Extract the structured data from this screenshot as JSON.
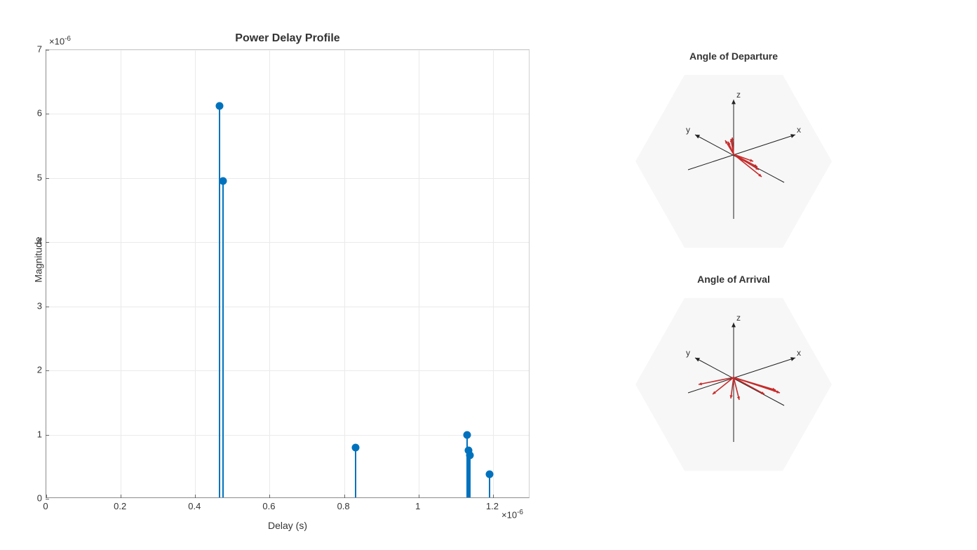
{
  "chart_data": [
    {
      "type": "stem",
      "title": "Power Delay Profile",
      "xlabel": "Delay (s)",
      "ylabel": "Magnitude",
      "xlim": [
        0,
        1.3e-06
      ],
      "ylim": [
        0,
        7e-06
      ],
      "x_exponent": "×10⁻⁶",
      "y_exponent": "×10⁻⁶",
      "xticks": [
        0,
        0.2,
        0.4,
        0.6,
        0.8,
        1.0,
        1.2
      ],
      "yticks": [
        0,
        1,
        2,
        3,
        4,
        5,
        6,
        7
      ],
      "points": [
        {
          "x": 4.65e-07,
          "y": 6.12e-06
        },
        {
          "x": 4.75e-07,
          "y": 4.95e-06
        },
        {
          "x": 8.3e-07,
          "y": 8e-07
        },
        {
          "x": 1.13e-06,
          "y": 1e-06
        },
        {
          "x": 1.135e-06,
          "y": 7.6e-07
        },
        {
          "x": 1.138e-06,
          "y": 6.8e-07
        },
        {
          "x": 1.19e-06,
          "y": 3.8e-07
        }
      ]
    },
    {
      "type": "vector3d",
      "title": "Angle of Departure",
      "axis_labels": {
        "x": "x",
        "y": "y",
        "z": "z"
      },
      "vectors": [
        {
          "dx": 28,
          "dy": 10
        },
        {
          "dx": 34,
          "dy": 18
        },
        {
          "dx": 36,
          "dy": 22
        },
        {
          "dx": 40,
          "dy": 32
        },
        {
          "dx": -8,
          "dy": -18
        },
        {
          "dx": -4,
          "dy": -22
        },
        {
          "dx": -12,
          "dy": -20
        },
        {
          "dx": -2,
          "dy": -24
        }
      ]
    },
    {
      "type": "vector3d",
      "title": "Angle of Arrival",
      "axis_labels": {
        "x": "x",
        "y": "y",
        "z": "z"
      },
      "vectors": [
        {
          "dx": 60,
          "dy": 18
        },
        {
          "dx": 66,
          "dy": 22
        },
        {
          "dx": 62,
          "dy": 20
        },
        {
          "dx": 44,
          "dy": 24
        },
        {
          "dx": 8,
          "dy": 32
        },
        {
          "dx": -4,
          "dy": 30
        },
        {
          "dx": -30,
          "dy": 24
        },
        {
          "dx": -50,
          "dy": 10
        }
      ]
    }
  ],
  "plot": {
    "title": "Power Delay Profile",
    "xlabel": "Delay (s)",
    "ylabel": "Magnitude",
    "y_exp_prefix": "×10",
    "y_exp_sup": "-6",
    "x_exp_prefix": "×10",
    "x_exp_sup": "-6",
    "xticklabels": [
      "0",
      "0.2",
      "0.4",
      "0.6",
      "0.8",
      "1",
      "1.2"
    ],
    "yticklabels": [
      "0",
      "1",
      "2",
      "3",
      "4",
      "5",
      "6",
      "7"
    ]
  },
  "right": {
    "aod_title": "Angle of Departure",
    "aoa_title": "Angle of Arrival",
    "ax_x": "x",
    "ax_y": "y",
    "ax_z": "z"
  }
}
